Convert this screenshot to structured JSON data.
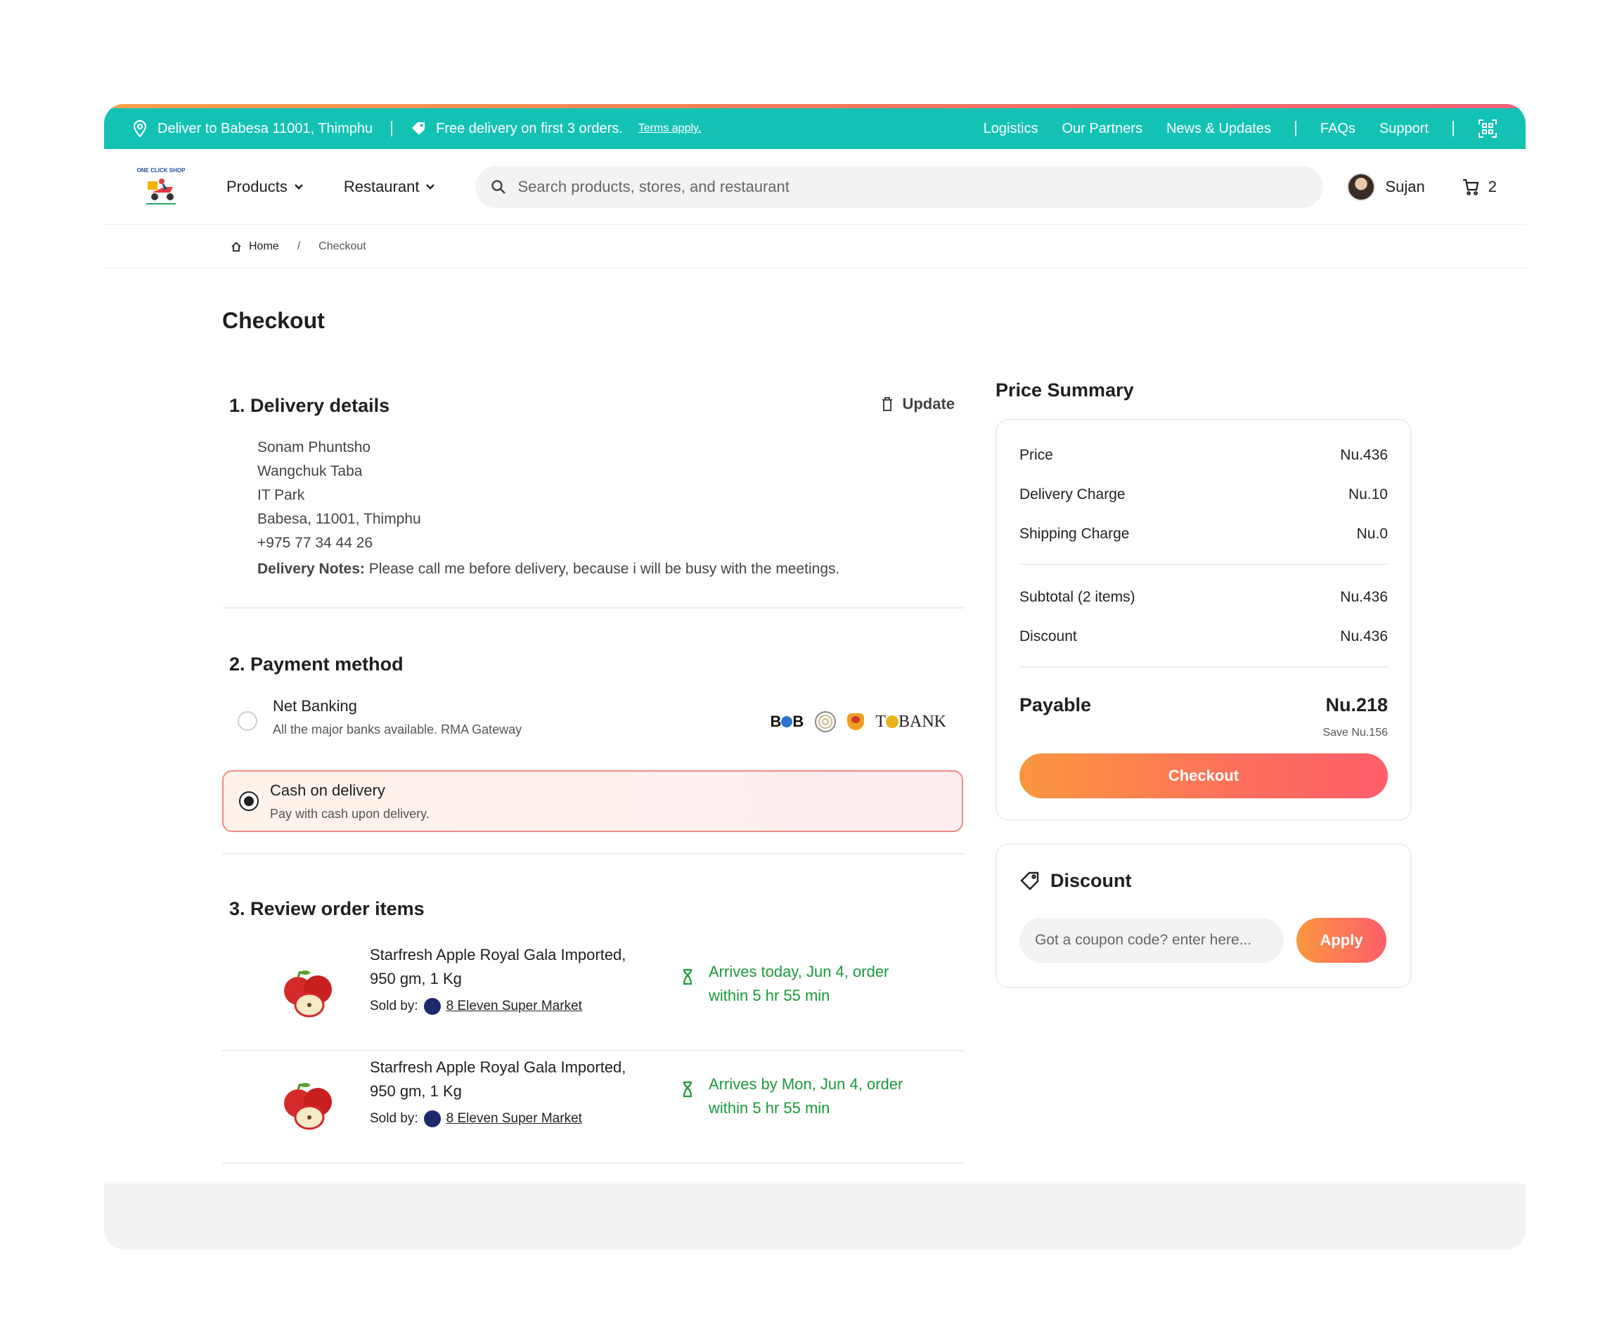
{
  "topbar": {
    "deliver_to": "Deliver to Babesa 11001, Thimphu",
    "promo": "Free delivery on first 3 orders.",
    "terms": "Terms apply.",
    "links": [
      "Logistics",
      "Our Partners",
      "News & Updates",
      "FAQs",
      "Support"
    ]
  },
  "header": {
    "logo_text": "ONE CLICK SHOP",
    "nav": [
      "Products",
      "Restaurant"
    ],
    "search_placeholder": "Search products, stores, and restaurant",
    "user_name": "Sujan",
    "cart_count": "2"
  },
  "breadcrumb": {
    "home": "Home",
    "sep": "/",
    "current": "Checkout"
  },
  "page_title": "Checkout",
  "delivery": {
    "heading": "1. Delivery details",
    "update_label": "Update",
    "address_lines": [
      "Sonam Phuntsho",
      "Wangchuk Taba",
      "IT Park",
      "Babesa, 11001, Thimphu",
      "+975 77 34 44 26"
    ],
    "notes_label": "Delivery Notes:",
    "notes_text": "Please call me before delivery, because i will be busy with the meetings."
  },
  "payment": {
    "heading": "2. Payment method",
    "options": [
      {
        "title": "Net Banking",
        "subtitle": "All the major banks available. RMA Gateway",
        "selected": false
      },
      {
        "title": "Cash on delivery",
        "subtitle": "Pay with cash upon delivery.",
        "selected": true
      }
    ],
    "bank_logos": {
      "bob": "B",
      "bob_end": "B",
      "tbank_start": "T",
      "tbank_end": "BANK"
    }
  },
  "review": {
    "heading": "3. Review order items",
    "items": [
      {
        "name_line1": "Starfresh Apple Royal Gala Imported,",
        "name_line2": "950 gm, 1 Kg",
        "sold_by_label": "Sold by:",
        "seller": "8 Eleven Super Market",
        "arrive_line1": "Arrives today, Jun 4, order",
        "arrive_line2": "within 5 hr 55 min"
      },
      {
        "name_line1": "Starfresh Apple Royal Gala Imported,",
        "name_line2": "950 gm, 1 Kg",
        "sold_by_label": "Sold by:",
        "seller": "8 Eleven Super Market",
        "arrive_line1": "Arrives by Mon, Jun 4, order",
        "arrive_line2": "within 5 hr 55 min"
      }
    ]
  },
  "summary": {
    "heading": "Price Summary",
    "rows": [
      {
        "label": "Price",
        "value": "Nu.436"
      },
      {
        "label": "Delivery Charge",
        "value": "Nu.10"
      },
      {
        "label": "Shipping Charge",
        "value": "Nu.0"
      },
      {
        "label": "Subtotal (2 items)",
        "value": "Nu.436"
      },
      {
        "label": "Discount",
        "value": "Nu.436"
      }
    ],
    "payable_label": "Payable",
    "payable_value": "Nu.218",
    "save_text": "Save Nu.156",
    "checkout_label": "Checkout"
  },
  "discount": {
    "heading": "Discount",
    "coupon_placeholder": "Got a coupon code? enter here...",
    "apply_label": "Apply"
  },
  "colors": {
    "topbar": "#14c2b4",
    "accent_orange": "#fb9740",
    "accent_pink": "#fd5e6a",
    "arrive_green": "#1a9a3a"
  },
  "icons": [
    "location-pin-icon",
    "tag-icon",
    "qr-scan-icon",
    "chevron-down-icon",
    "search-icon",
    "cart-icon",
    "home-icon",
    "trash-icon",
    "hourglass-icon",
    "discount-tag-icon"
  ]
}
